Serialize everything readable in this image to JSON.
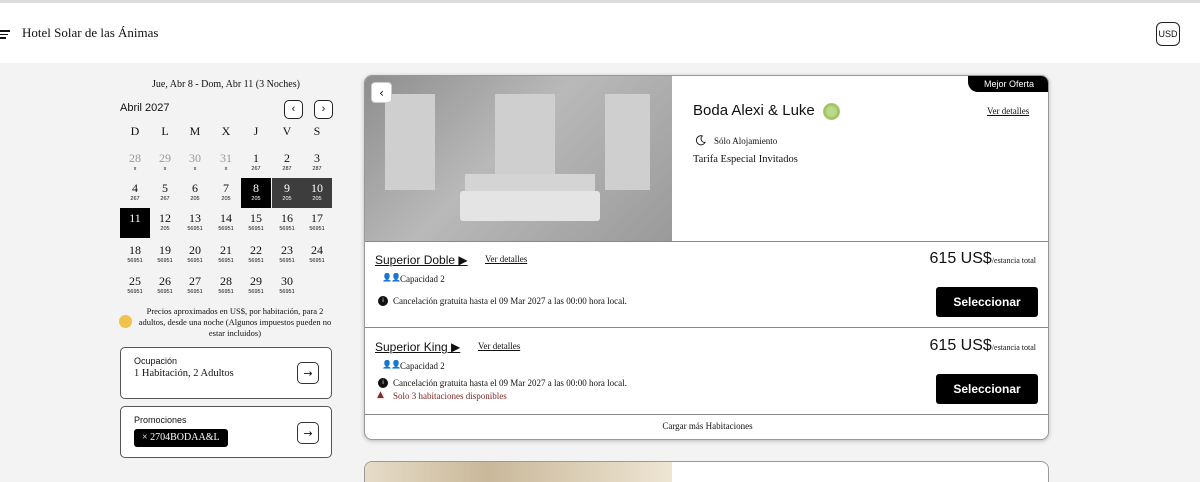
{
  "header": {
    "hotel_name": "Hotel Solar de las Ánimas",
    "currency": "USD"
  },
  "booking": {
    "date_range": "Jue, Abr 8 - Dom, Abr 11 (3 Noches)"
  },
  "calendar": {
    "month": "Abril 2027",
    "prev_icon": "chevron-left-icon",
    "next_icon": "chevron-right-icon",
    "weekdays": [
      "D",
      "L",
      "M",
      "X",
      "J",
      "V",
      "S"
    ],
    "weeks": [
      [
        {
          "d": "28",
          "p": "x",
          "s": "past"
        },
        {
          "d": "29",
          "p": "x",
          "s": "past"
        },
        {
          "d": "30",
          "p": "x",
          "s": "past"
        },
        {
          "d": "31",
          "p": "x",
          "s": "past"
        },
        {
          "d": "1",
          "p": "267",
          "s": ""
        },
        {
          "d": "2",
          "p": "287",
          "s": ""
        },
        {
          "d": "3",
          "p": "287",
          "s": ""
        }
      ],
      [
        {
          "d": "4",
          "p": "267",
          "s": ""
        },
        {
          "d": "5",
          "p": "267",
          "s": ""
        },
        {
          "d": "6",
          "p": "205",
          "s": ""
        },
        {
          "d": "7",
          "p": "205",
          "s": ""
        },
        {
          "d": "8",
          "p": "205",
          "s": "sel"
        },
        {
          "d": "9",
          "p": "205",
          "s": "range"
        },
        {
          "d": "10",
          "p": "205",
          "s": "range"
        }
      ],
      [
        {
          "d": "11",
          "p": "",
          "s": "sel"
        },
        {
          "d": "12",
          "p": "205",
          "s": ""
        },
        {
          "d": "13",
          "p": "56951",
          "s": ""
        },
        {
          "d": "14",
          "p": "56951",
          "s": ""
        },
        {
          "d": "15",
          "p": "56951",
          "s": ""
        },
        {
          "d": "16",
          "p": "56951",
          "s": ""
        },
        {
          "d": "17",
          "p": "56951",
          "s": ""
        }
      ],
      [
        {
          "d": "18",
          "p": "56951",
          "s": ""
        },
        {
          "d": "19",
          "p": "56951",
          "s": ""
        },
        {
          "d": "20",
          "p": "56951",
          "s": ""
        },
        {
          "d": "21",
          "p": "56951",
          "s": ""
        },
        {
          "d": "22",
          "p": "56951",
          "s": ""
        },
        {
          "d": "23",
          "p": "56951",
          "s": ""
        },
        {
          "d": "24",
          "p": "56951",
          "s": ""
        }
      ],
      [
        {
          "d": "25",
          "p": "56951",
          "s": ""
        },
        {
          "d": "26",
          "p": "56951",
          "s": ""
        },
        {
          "d": "27",
          "p": "56951",
          "s": ""
        },
        {
          "d": "28",
          "p": "56951",
          "s": ""
        },
        {
          "d": "29",
          "p": "56951",
          "s": ""
        },
        {
          "d": "30",
          "p": "56951",
          "s": ""
        },
        {
          "d": "",
          "p": "",
          "s": ""
        }
      ]
    ]
  },
  "price_note": "Precios aproximados en US$, por habitación, para 2 adultos, desde una noche (Algunos impuestos pueden no estar incluidos)",
  "occupancy": {
    "label": "Ocupación",
    "value": "1 Habitación, 2 Adultos"
  },
  "promotions": {
    "label": "Promociones",
    "code": "× 2704BODAA&L"
  },
  "offer": {
    "badge": "Mejor Oferta",
    "title": "Boda Alexi & Luke",
    "details_link": "Ver detalles",
    "meal_plan": "Sólo Alojamiento",
    "rate_name": "Tarifa Especial Invitados",
    "rooms": [
      {
        "name": "Superior Doble ▶",
        "details": "Ver detalles",
        "capacity": "Capacidad 2",
        "cancellation": "Cancelación gratuita hasta el 09 Mar 2027 a las 00:00 hora local.",
        "warning": "",
        "price": "615 US$",
        "price_suffix": "/estancia total",
        "select": "Seleccionar"
      },
      {
        "name": "Superior King ▶",
        "details": "Ver detalles",
        "capacity": "Capacidad 2",
        "cancellation": "Cancelación gratuita hasta el 09 Mar 2027 a las 00:00 hora local.",
        "warning": "Solo 3 habitaciones disponibles",
        "price": "615 US$",
        "price_suffix": "/estancia total",
        "select": "Seleccionar"
      }
    ],
    "load_more": "Cargar más Habitaciones"
  }
}
